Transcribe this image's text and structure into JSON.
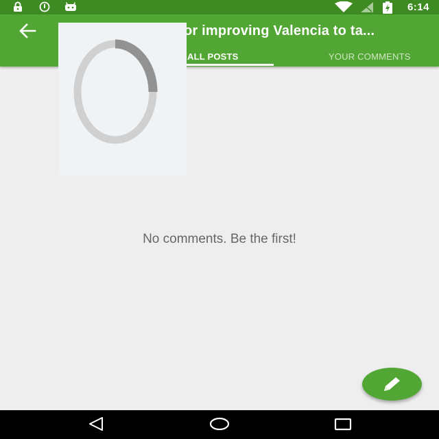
{
  "status_bar": {
    "time": "6:14",
    "left_icons": [
      "lock-icon",
      "sync-icon",
      "android-icon"
    ],
    "right_icons": [
      "wifi-icon",
      "signal-icon",
      "battery-charging-icon"
    ]
  },
  "app_bar": {
    "title": "or improving Valencia to ta...",
    "back_icon": "arrow-left-icon",
    "tabs": [
      {
        "label": "ALL POSTS",
        "active": true
      },
      {
        "label": "YOUR COMMENTS",
        "active": false
      }
    ]
  },
  "content": {
    "empty_message": "No comments. Be the first!"
  },
  "fab": {
    "icon": "pencil-icon"
  },
  "nav_bar": {
    "icons": [
      "back-triangle-icon",
      "home-circle-icon",
      "recents-square-icon"
    ]
  },
  "colors": {
    "status_bar": "#3d8b22",
    "app_bar": "#52a634",
    "background": "#eeeeee",
    "text_muted": "#666666"
  }
}
